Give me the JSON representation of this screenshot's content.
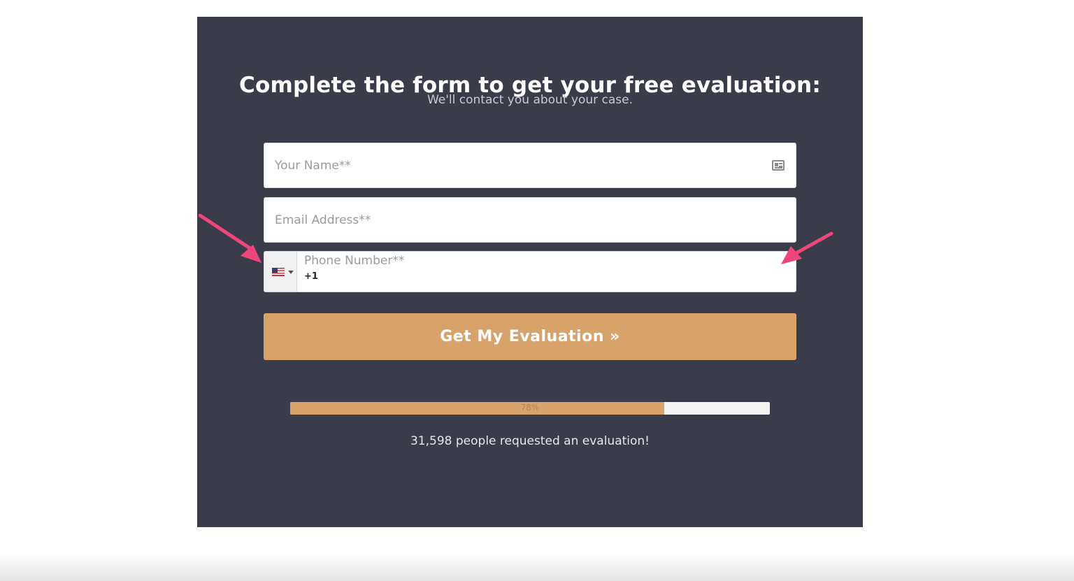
{
  "form": {
    "title": "Complete the form to get your free evaluation:",
    "subtitle": "We'll contact you about your case.",
    "name_placeholder": "Your Name**",
    "email_placeholder": "Email Address**",
    "phone_label": "Phone Number**",
    "phone_prefix": "+1",
    "country_flag": "us-flag-icon",
    "submit_label": "Get My Evaluation »"
  },
  "progress": {
    "value_percent": 78,
    "label": "78%",
    "count_text": "31,598 people requested an evaluation!"
  },
  "colors": {
    "panel": "#3b3c4a",
    "accent": "#d8a26b",
    "annotation_arrow": "#f0457a"
  }
}
